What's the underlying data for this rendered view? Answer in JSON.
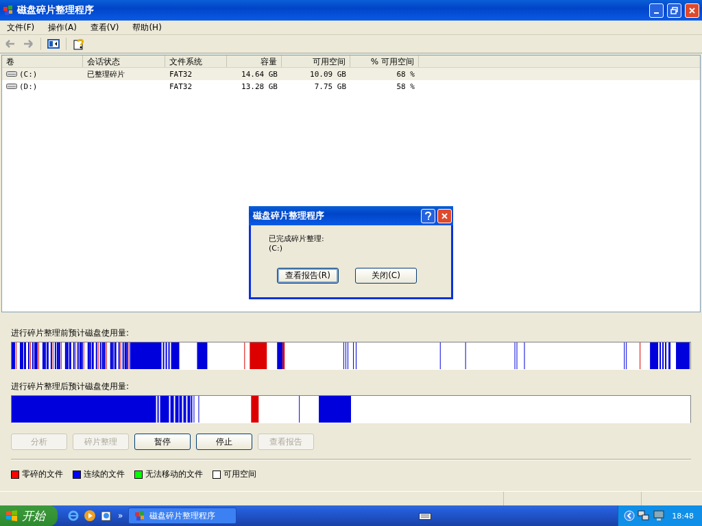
{
  "window": {
    "title": "磁盘碎片整理程序"
  },
  "menu": [
    {
      "label": "文件(F)"
    },
    {
      "label": "操作(A)"
    },
    {
      "label": "查看(V)"
    },
    {
      "label": "帮助(H)"
    }
  ],
  "toolbar": [
    {
      "kind": "back",
      "disabled": true
    },
    {
      "kind": "forward",
      "disabled": true
    },
    {
      "kind": "panel",
      "disabled": false
    },
    {
      "kind": "help",
      "disabled": false
    }
  ],
  "table": {
    "columns": [
      "卷",
      "会话状态",
      "文件系统",
      "容量",
      "可用空间",
      "% 可用空间"
    ],
    "rows": [
      {
        "selected": true,
        "cells": [
          "(C:)",
          "已整理碎片",
          "FAT32",
          "14.64 GB",
          "10.09 GB",
          "68 %"
        ]
      },
      {
        "selected": false,
        "cells": [
          "(D:)",
          "",
          "FAT32",
          "13.28 GB",
          "7.75 GB",
          "58 %"
        ]
      }
    ]
  },
  "before_label": "进行碎片整理前预计磁盘使用量:",
  "after_label": "进行碎片整理后预计磁盘使用量:",
  "buttons": [
    {
      "label": "分析",
      "disabled": true
    },
    {
      "label": "碎片整理",
      "disabled": true
    },
    {
      "label": "暂停",
      "disabled": false
    },
    {
      "label": "停止",
      "disabled": false
    },
    {
      "label": "查看报告",
      "disabled": true
    }
  ],
  "legend": [
    {
      "label": "零碎的文件",
      "color": "#ff0000"
    },
    {
      "label": "连续的文件",
      "color": "#0000ff"
    },
    {
      "label": "无法移动的文件",
      "color": "#00ff00"
    },
    {
      "label": "可用空间",
      "color": "#ffffff"
    }
  ],
  "dialog": {
    "title": "磁盘碎片整理程序",
    "message": "已完成碎片整理:",
    "volume": "(C:)",
    "buttons": [
      {
        "label": "查看报告(R)",
        "selected": true
      },
      {
        "label": "关闭(C)",
        "selected": false
      }
    ]
  },
  "taskbar": {
    "start": "开始",
    "chevron": "»",
    "tasks": [
      {
        "label": "磁盘碎片整理程序",
        "selected": false
      }
    ],
    "clock": "18:48"
  }
}
